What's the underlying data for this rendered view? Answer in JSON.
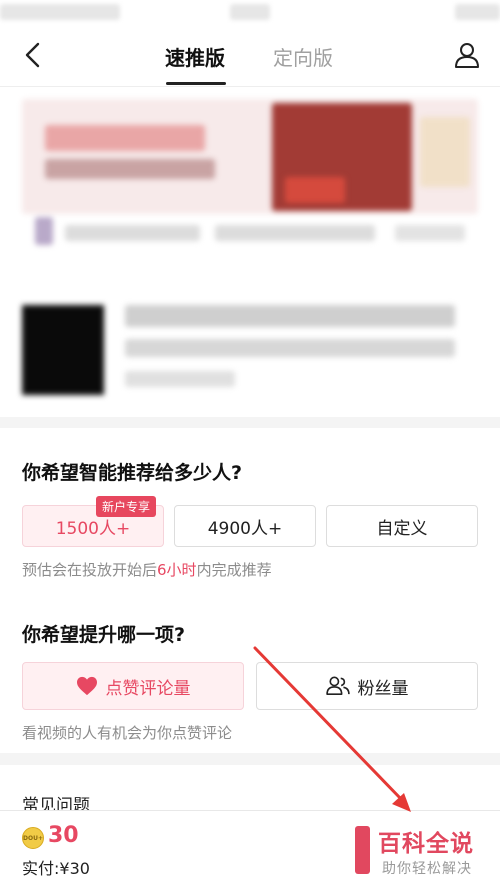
{
  "nav": {
    "tab_active": "速推版",
    "tab_inactive": "定向版"
  },
  "section_people": {
    "title": "你希望智能推荐给多少人?",
    "badge": "新户专享",
    "options": [
      "1500人+",
      "4900人+",
      "自定义"
    ],
    "hint_before": "预估会在投放开始后",
    "hint_highlight": "6小时",
    "hint_after": "内完成推荐"
  },
  "section_goal": {
    "title": "你希望提升哪一项?",
    "options": [
      "点赞评论量",
      "粉丝量"
    ],
    "hint": "看视频的人有机会为你点赞评论"
  },
  "faq": {
    "title": "常见问题"
  },
  "bottom": {
    "coin_label": "DOU+",
    "coin_amount": "30",
    "paid": "实付:¥30"
  },
  "watermark": {
    "title": "百科全说",
    "subtitle": "助你轻松解决"
  },
  "colors": {
    "accent": "#e74862",
    "arrow": "#e53935"
  },
  "icons": [
    "chevron-left-icon",
    "user-icon",
    "heart-icon",
    "followers-icon",
    "coin-icon"
  ]
}
